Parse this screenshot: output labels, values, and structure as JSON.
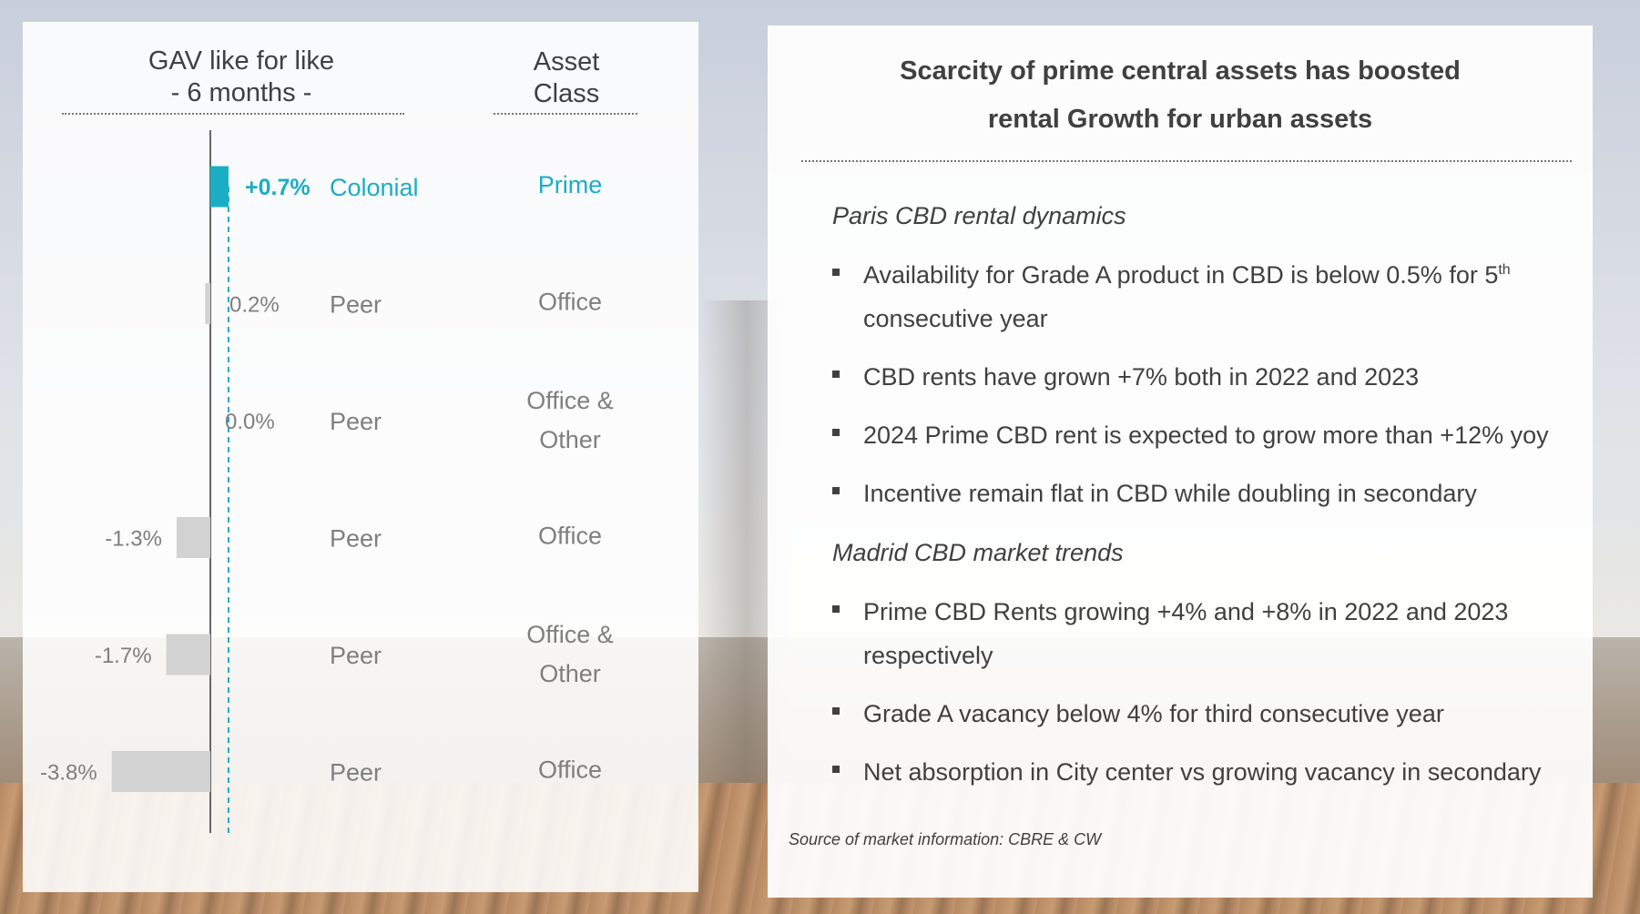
{
  "left": {
    "header_gav": [
      "GAV like for like",
      "- 6 months -"
    ],
    "header_class": [
      "Asset",
      "Class"
    ]
  },
  "chart_data": {
    "type": "bar",
    "orientation": "horizontal",
    "title": "GAV like for like - 6 months -",
    "categories": [
      "Colonial",
      "Peer",
      "Peer",
      "Peer",
      "Peer",
      "Peer"
    ],
    "values": [
      0.7,
      -0.2,
      0.0,
      -1.3,
      -1.7,
      -3.8
    ],
    "value_labels": [
      "+0.7%",
      "0.2%",
      "0.0%",
      "-1.3%",
      "-1.7%",
      "-3.8%"
    ],
    "asset_class": [
      [
        "Prime"
      ],
      [
        "Office"
      ],
      [
        "Office &",
        "Other"
      ],
      [
        "Office"
      ],
      [
        "Office &",
        "Other"
      ],
      [
        "Office"
      ]
    ],
    "highlight_index": 0,
    "colors": {
      "highlight": "#1aaec5",
      "peer": "#d2d2d2",
      "axis": "#666666",
      "reference_line": "#1aaec5"
    },
    "reference_line_at": 0.7,
    "grid": false,
    "legend": "none"
  },
  "right": {
    "title_lines": [
      "Scarcity of prime central assets has boosted",
      "rental Growth for urban assets"
    ],
    "section1_title": "Paris CBD rental dynamics",
    "section1_bullets": [
      {
        "text": "Availability for Grade A product in CBD is below 0.5% for 5",
        "sup": "th",
        "text2": "consecutive year"
      },
      {
        "text": "CBD rents have grown +7% both in 2022 and 2023"
      },
      {
        "text": "2024 Prime CBD rent is expected to grow more than +12% yoy"
      },
      {
        "text": "Incentive remain flat in CBD while doubling in secondary"
      }
    ],
    "section2_title": "Madrid CBD market trends",
    "section2_bullets": [
      {
        "text": "Prime CBD Rents growing +4% and +8% in 2022 and 2023",
        "text2": "respectively"
      },
      {
        "text": "Grade A vacancy below 4% for third consecutive year"
      },
      {
        "text": "Net absorption in City center vs growing vacancy in secondary"
      }
    ],
    "source": "Source of market information: CBRE & CW"
  }
}
